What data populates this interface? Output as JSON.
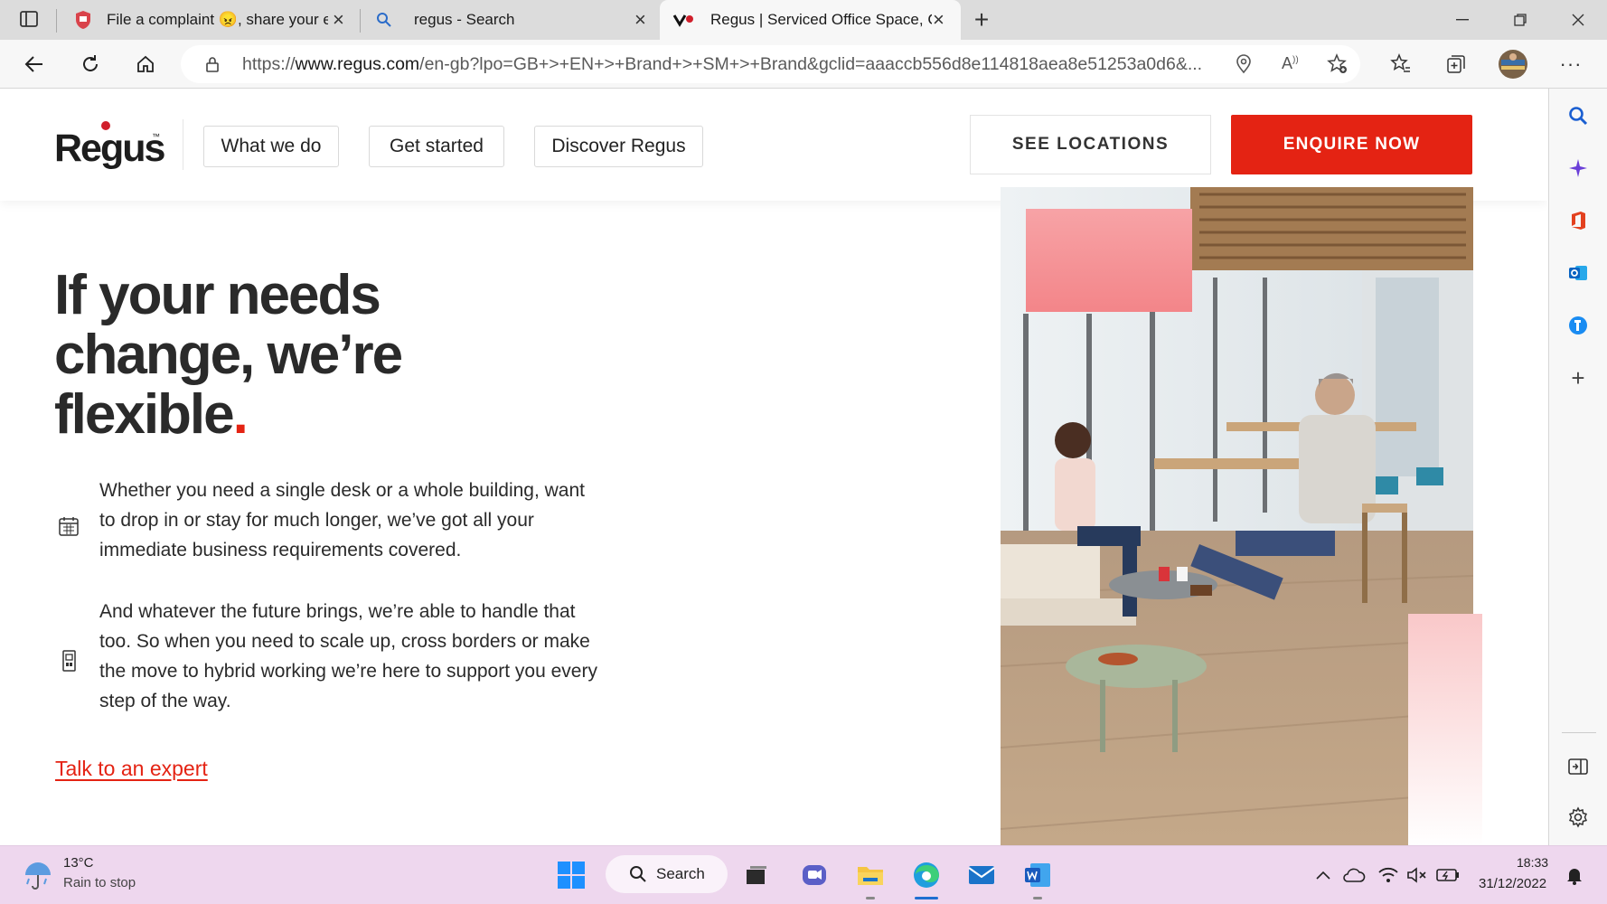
{
  "browser": {
    "tabs": [
      {
        "title": "File a complaint 😠, share your e",
        "active": false
      },
      {
        "title": "regus - Search",
        "active": false
      },
      {
        "title": "Regus | Serviced Office Space, Co",
        "active": true
      }
    ],
    "url_scheme": "https://",
    "url_host": "www.regus.com",
    "url_path": "/en-gb?lpo=GB+>+EN+>+Brand+>+SM+>+Brand&gclid=aaaccb556d8e114818aea8e51253a0d6&..."
  },
  "site": {
    "logo_text": "Regus",
    "logo_tm": "™",
    "nav": [
      "What we do",
      "Get started",
      "Discover Regus"
    ],
    "see_locations_label": "SEE LOCATIONS",
    "enquire_label": "ENQUIRE NOW",
    "brand_color": "#e42313"
  },
  "hero": {
    "headline_lines": [
      "If your needs",
      "change, we’re",
      "flexible"
    ],
    "headline_dot": ".",
    "features": [
      {
        "icon": "calendar-icon",
        "text": "Whether you need a single desk or a whole building, want to drop in or stay for much longer, we’ve got all your immediate business requirements covered."
      },
      {
        "icon": "building-icon",
        "text": "And whatever the future brings, we’re able to handle that too. So when you need to scale up, cross borders or make the move to hybrid working we’re here to support you every step of the way."
      }
    ],
    "cta_label": "Talk to an expert"
  },
  "taskbar": {
    "weather_temp": "13°C",
    "weather_desc": "Rain to stop",
    "search_label": "Search",
    "time": "18:33",
    "date": "31/12/2022"
  }
}
